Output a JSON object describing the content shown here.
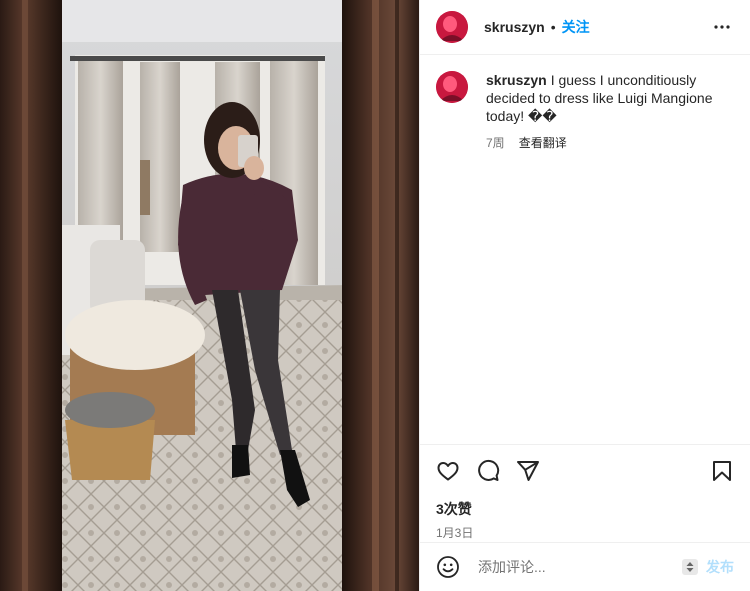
{
  "header": {
    "username": "skruszyn",
    "separator": "•",
    "follow_label": "关注",
    "more_icon": "more-horizontal-icon"
  },
  "caption": {
    "username": "skruszyn",
    "text": "I guess I unconditiously decided to dress like Luigi Mangione today! ��",
    "age": "7周",
    "translate_label": "查看翻译"
  },
  "actions": {
    "like_icon": "heart-icon",
    "comment_icon": "comment-icon",
    "share_icon": "send-icon",
    "save_icon": "bookmark-icon",
    "likes_label": "3次赞",
    "date_label": "1月3日"
  },
  "comment_box": {
    "emoji_icon": "emoji-icon",
    "placeholder": "添加评论...",
    "post_label": "发布"
  },
  "colors": {
    "link_blue": "#0095f6",
    "post_disabled": "#b2dffc",
    "secondary_text": "#737373",
    "divider": "#efefef"
  }
}
